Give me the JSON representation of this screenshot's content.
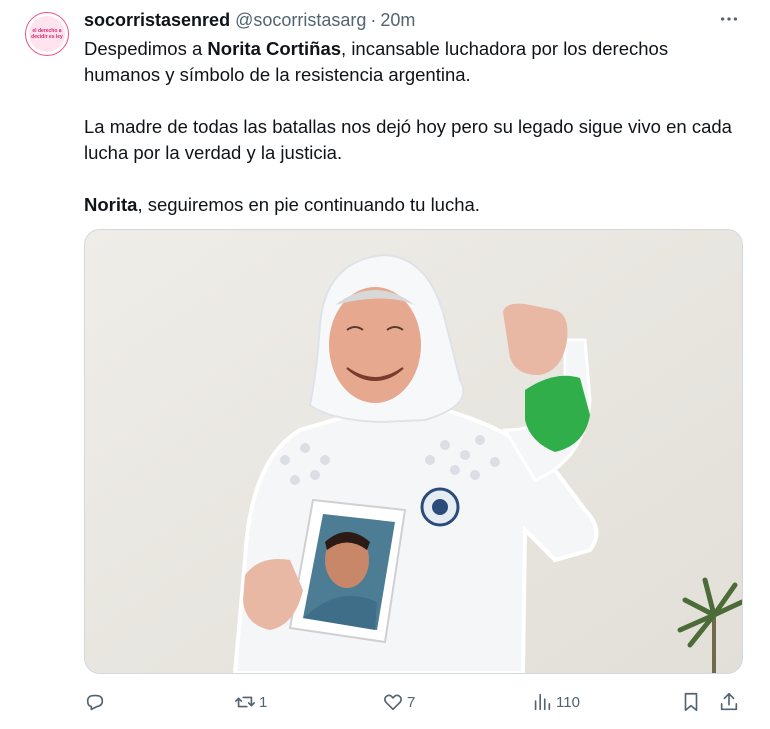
{
  "tweet": {
    "display_name": "socorristasenred",
    "handle": "@socorristasarg",
    "separator": "·",
    "time": "20m",
    "more_label": "···",
    "avatar_text": "el derecho a decidir es ley",
    "paragraph1_pre": "Despedimos a ",
    "paragraph1_bold": "Norita Cortiñas",
    "paragraph1_post": ", incansable luchadora por los derechos humanos y símbolo de la resistencia argentina.",
    "paragraph2": "La madre de todas las batallas nos dejó hoy pero su legado sigue vivo en cada lucha por la verdad y la justicia.",
    "paragraph3_bold": "Norita",
    "paragraph3_post": ", seguiremos en pie continuando tu lucha."
  },
  "actions": {
    "reply_count": "",
    "retweet_count": "1",
    "like_count": "7",
    "views_count": "110"
  },
  "icons": {
    "reply": "reply-icon",
    "retweet": "retweet-icon",
    "like": "heart-icon",
    "views": "views-icon",
    "bookmark": "bookmark-icon",
    "share": "share-icon"
  },
  "colors": {
    "text_primary": "#0f1419",
    "text_secondary": "#536471",
    "border": "#cfd9de",
    "brand_pink": "#ef4f8a",
    "bandana_green": "#2fae4a"
  }
}
